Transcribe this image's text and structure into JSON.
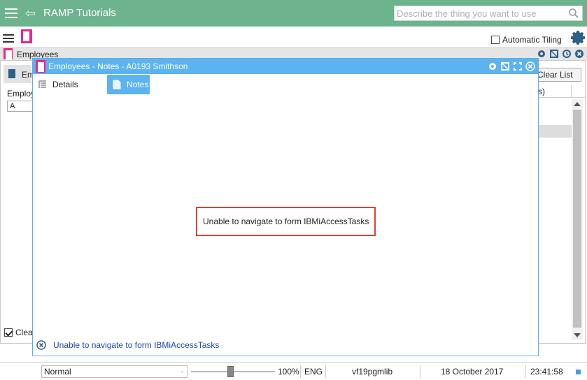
{
  "app": {
    "title": "RAMP Tutorials",
    "search_placeholder": "Describe the thing you want to use"
  },
  "toolbar": {
    "auto_tiling_label": "Automatic Tiling",
    "auto_tiling_checked": false
  },
  "employees_window": {
    "title": "Employees",
    "tab_label": "Em",
    "field_label": "Employ",
    "field_value": "A",
    "clear_list_label": "Clear List",
    "column_header": "s)",
    "clear_checkbox_label": "Clea",
    "clear_checkbox_checked": true
  },
  "notes_modal": {
    "title": "Employees - Notes - A0193 Smithson",
    "tabs": [
      {
        "label": "Details",
        "active": false
      },
      {
        "label": "Notes",
        "active": true
      }
    ],
    "message": "Unable to navigate to form IBMiAccessTasks",
    "status_message": "Unable to navigate to form IBMiAccessTasks"
  },
  "statusbar": {
    "mode": "Normal",
    "zoom": "100%",
    "zoom_value": 0.5,
    "language": "ENG",
    "library": "vf19pgmlib",
    "date": "18 October 2017",
    "time": "23:41:58"
  },
  "colors": {
    "appbar": "#6db38e",
    "modal_title": "#5cb3ef",
    "accent_pink": "#e9268f",
    "error_border": "#d9423a"
  }
}
